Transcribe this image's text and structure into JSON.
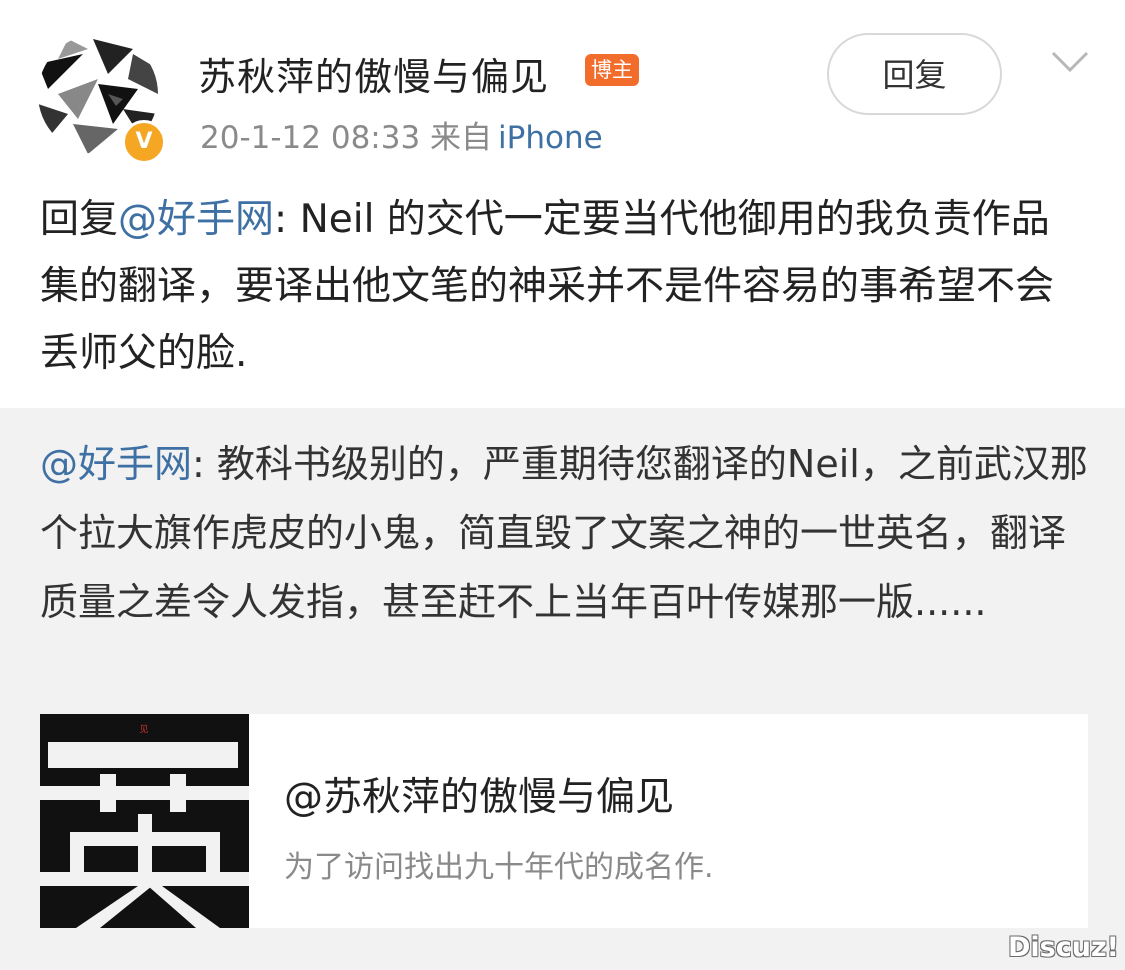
{
  "header": {
    "username": "苏秋萍的傲慢与偏见",
    "badge": "博主",
    "verified_badge": "V",
    "timestamp": "20-1-12 08:33",
    "source_prefix": "来自",
    "source": "iPhone",
    "reply_label": "回复",
    "avatar_icon": "abstract-geometric-avatar-icon",
    "menu_icon": "chevron-down-icon"
  },
  "post": {
    "reply_prefix": "回复",
    "mention": "@好手网",
    "text": ": Neil 的交代一定要当代他御用的我负责作品集的翻译，要译出他文笔的神采并不是件容易的事希望不会丢师父的脸."
  },
  "quoted": {
    "mention": "@好手网",
    "text": ": 教科书级别的，严重期待您翻译的Neil，之前武汉那个拉大旗作虎皮的小鬼，简直毁了文案之神的一世英名，翻译质量之差令人发指，甚至赶不上当年百叶传媒那一版......"
  },
  "card": {
    "title": "@苏秋萍的傲慢与偏见",
    "description": "为了访问找出九十年代的成名作.",
    "thumbnail_text": "一英",
    "thumbnail_small": "见"
  },
  "watermark": "Discuz!",
  "colors": {
    "link": "#3f70a3",
    "badge_orange": "#f26d2b",
    "verified_gold": "#f5a623",
    "quote_bg": "#f2f2f2"
  }
}
